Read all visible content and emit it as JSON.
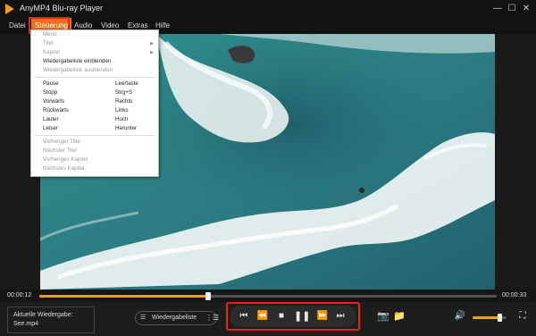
{
  "window": {
    "title": "AnyMP4 Blu-ray Player",
    "minimize_icon": "minimize-icon",
    "maximize_icon": "maximize-icon",
    "close_icon": "close-icon"
  },
  "menubar": {
    "items": [
      "Datei",
      "Steuerung",
      "Audio",
      "Video",
      "Extras",
      "Hilfe"
    ],
    "active_index": 1
  },
  "steuerung_menu": {
    "items": [
      {
        "label": "Menü",
        "shortcut": "",
        "submenu": false,
        "disabled": true
      },
      {
        "label": "Titel",
        "shortcut": "",
        "submenu": true,
        "disabled": true
      },
      {
        "label": "Kapitel",
        "shortcut": "",
        "submenu": true,
        "disabled": true
      },
      {
        "label": "Wiedergabeliste einblenden",
        "shortcut": "",
        "submenu": false,
        "disabled": false
      },
      {
        "label": "Wiedergabeliste ausblenden",
        "shortcut": "",
        "submenu": false,
        "disabled": true
      },
      {
        "label": "Pause",
        "shortcut": "Leertaste",
        "submenu": false,
        "disabled": false
      },
      {
        "label": "Stopp",
        "shortcut": "Strg+S",
        "submenu": false,
        "disabled": false
      },
      {
        "label": "Vorwärts",
        "shortcut": "Rechts",
        "submenu": false,
        "disabled": false
      },
      {
        "label": "Rückwärts",
        "shortcut": "Links",
        "submenu": false,
        "disabled": false
      },
      {
        "label": "Lauter",
        "shortcut": "Hoch",
        "submenu": false,
        "disabled": false
      },
      {
        "label": "Leiser",
        "shortcut": "Herunter",
        "submenu": false,
        "disabled": false
      },
      {
        "label": "Vorheriger Titel",
        "shortcut": "",
        "submenu": false,
        "disabled": true
      },
      {
        "label": "Nächster Titel",
        "shortcut": "",
        "submenu": false,
        "disabled": true
      },
      {
        "label": "Vorheriges Kapitel",
        "shortcut": "",
        "submenu": false,
        "disabled": true
      },
      {
        "label": "Nächstes Kapitel",
        "shortcut": "",
        "submenu": false,
        "disabled": true
      }
    ]
  },
  "progress": {
    "current": "00:00:12",
    "total": "00:00:33",
    "fraction": 0.37
  },
  "now_playing": {
    "label": "Aktuelle Wiedergabe:",
    "file": "See.mp4"
  },
  "playlist": {
    "label": "Wiedergabeliste"
  },
  "controls": {
    "icons": [
      "skip-to-start-icon",
      "rewind-icon",
      "stop-icon",
      "pause-icon",
      "fast-forward-icon",
      "skip-to-end-icon"
    ],
    "glyphs": [
      "⏮",
      "⏪",
      "■",
      "❚❚",
      "⏩",
      "⏭"
    ]
  },
  "volume": {
    "fraction": 0.8
  },
  "colors": {
    "accent": "#f29b1d",
    "highlight": "#e8231f",
    "menu_active": "#e8731a"
  }
}
